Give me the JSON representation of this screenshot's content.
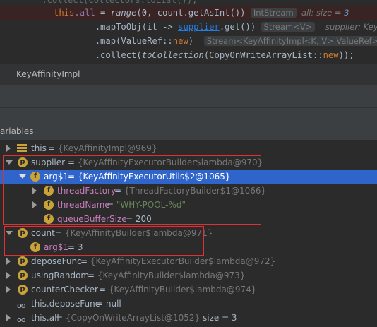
{
  "code": {
    "line0": "    .collect(Collectors.toList());",
    "line1": {
      "this": "this",
      "dot_all": ".all",
      "eq": " = ",
      "range": "range",
      "args_a": "(0, ",
      "count": "count",
      "args_b": ".getAsInt()) ",
      "hint": "IntStream",
      "inline_all": "all:",
      "inline_size": " size = ",
      "inline_size_val": "3"
    },
    "line2": {
      "prefix": "        .mapToObj(it -> ",
      "supplier": "supplier",
      "suffix": ".get()) ",
      "hint": "Stream<V>",
      "inline": "supplier: Key"
    },
    "line3": {
      "prefix": "        .map(ValueRef::",
      "kw_new": "new",
      "suffix": ")",
      "hint": "Stream<KeyAffinityImpl<K, V>.ValueRef>"
    },
    "line4": {
      "prefix": "        .collect(",
      "fn": "toCollection",
      "mid": "(CopyOnWriteArrayList::",
      "kw_new": "new",
      "suffix": "));"
    }
  },
  "breadcrumb": "KeyAffinityImpl",
  "panel_title": "ariables",
  "variables": [
    {
      "name": "this",
      "value": "{KeyAffinityImpl@969}"
    },
    {
      "name": "supplier",
      "value": "{KeyAffinityExecutorBuilder$lambda@970}"
    },
    {
      "name": "arg$1",
      "value": "{KeyAffinityExecutorUtils$2@1065}"
    },
    {
      "name": "threadFactory",
      "value": "{ThreadFactoryBuilder$1@1066}"
    },
    {
      "name": "threadName",
      "value": "\"WHY-POOL-%d\""
    },
    {
      "name": "queueBufferSize",
      "value": "200"
    },
    {
      "name": "count",
      "value": "{KeyAffinityBuilder$lambda@971}"
    },
    {
      "name": "arg$1",
      "value": "3"
    },
    {
      "name": "deposeFunc",
      "value": "{KeyAffinityExecutorBuilder$lambda@972}"
    },
    {
      "name": "usingRandom",
      "value": "{KeyAffinityBuilder$lambda@973}"
    },
    {
      "name": "counterChecker",
      "value": "{KeyAffinityBuilder$lambda@974}"
    },
    {
      "name": "this.deposeFunc",
      "value": "null"
    },
    {
      "name": "this.all",
      "value": "{CopyOnWriteArrayList@1052}",
      "extra": "size = 3"
    }
  ],
  "eq": " = ",
  "icons": {
    "field_letter": "f",
    "param_letter": "p",
    "watch": "oo"
  },
  "colors": {
    "selection": "#2f65ca",
    "highlight_box": "#e0302f",
    "field_icon": "#c9a23a"
  }
}
